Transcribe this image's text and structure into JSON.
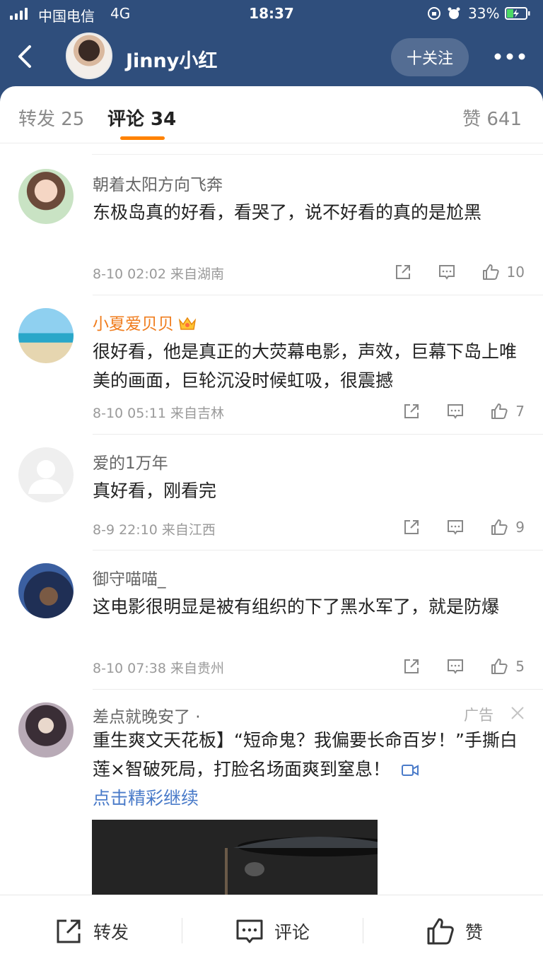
{
  "status_bar": {
    "carrier": "中国电信",
    "network": "4G",
    "time": "18:37",
    "battery": "33%"
  },
  "header": {
    "title": "Jinny小红",
    "follow_label": "十关注"
  },
  "tabs": {
    "repost": "转发 25",
    "comment": "评论 34",
    "like": "赞 641"
  },
  "comments": [
    {
      "name": "朝着太阳方向飞奔",
      "text": "东极岛真的好看，看哭了，说不好看的真的是尬黑",
      "meta": "8-10 02:02  来自湖南",
      "likes": "10"
    },
    {
      "name": "小夏爱贝贝",
      "text": "很好看，他是真正的大荧幕电影，声效，巨幕下岛上唯美的画面，巨轮沉没时候虹吸，很震撼",
      "meta": "8-10 05:11  来自吉林",
      "likes": "7"
    },
    {
      "name": "爱的1万年",
      "text": "真好看，刚看完",
      "meta": "8-9 22:10  来自江西",
      "likes": "9"
    },
    {
      "name": "御守喵喵_",
      "text": "这电影很明显是被有组织的下了黑水军了，就是防爆",
      "meta": "8-10 07:38  来自贵州",
      "likes": "5"
    }
  ],
  "ad": {
    "name": "差点就晚安了 ·",
    "tag": "广告",
    "text": "重生爽文天花板】“短命鬼？我偏要长命百岁！”手撕白莲×智破死局，打脸名场面爽到窒息！",
    "link": "点击精彩继续"
  },
  "bottom_bar": {
    "repost": "转发",
    "comment": "评论",
    "like": "赞"
  },
  "colors": {
    "header_bg": "#2f4e7c",
    "accent": "#ff8200",
    "vip_name": "#f07d1e",
    "link": "#4a7bc9"
  }
}
